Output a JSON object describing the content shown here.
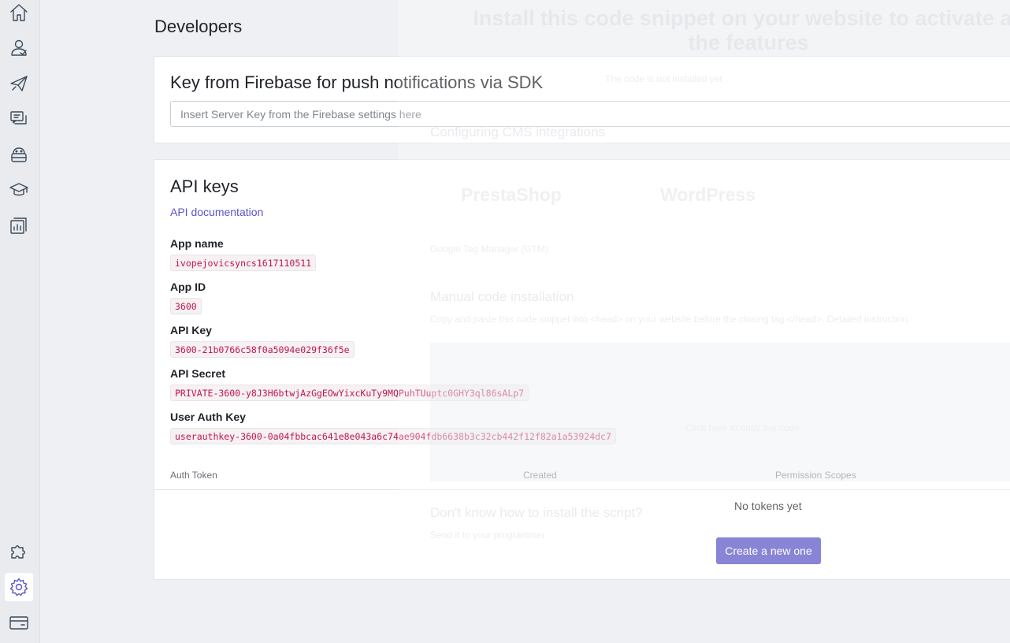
{
  "sidebar": {
    "top_icons": [
      "home-icon",
      "users-icon",
      "paper-plane-icon",
      "chat-icon",
      "bot-icon",
      "graduation-cap-icon",
      "reports-icon"
    ],
    "bottom_icons": [
      "puzzle-icon",
      "gear-icon",
      "card-icon"
    ],
    "active": "gear-icon"
  },
  "page": {
    "title": "Developers"
  },
  "firebase": {
    "title": "Key from Firebase for push notifications via SDK",
    "input_placeholder": "Insert Server Key from the Firebase settings here",
    "input_value": ""
  },
  "api": {
    "title": "API keys",
    "doc_link": "API documentation",
    "fields": [
      {
        "label": "App name",
        "value": "ivopejovicsyncs1617110511"
      },
      {
        "label": "App ID",
        "value": "3600"
      },
      {
        "label": "API Key",
        "value": "3600-21b0766c58f0a5094e029f36f5e"
      },
      {
        "label": "API Secret",
        "value": "PRIVATE-3600-y8J3H6btwjAzGgEOwYixcKuTy9MQPuhTUuptc0GHY3ql86sALp7"
      },
      {
        "label": "User Auth Key",
        "value": "userauthkey-3600-0a04fbbcac641e8e043a6c74ae904fdb6638b3c32cb442f12f82a1a53924dc7"
      }
    ],
    "table": {
      "headers": [
        "Auth Token",
        "Created",
        "Permission Scopes"
      ],
      "empty": "No tokens yet",
      "create_button": "Create a new one"
    }
  },
  "background_panel": {
    "heading": "Install this code snippet on your website to activate all the features",
    "status_text": "The code is not installed yet",
    "cms_heading": "Configuring CMS integrations",
    "cms_logos": [
      "PrestaShop",
      "WordPress"
    ],
    "gtm_text": "Google Tag Manager (GTM)",
    "manual_heading": "Manual code installation",
    "manual_text": "Copy and paste this code snippet into <head> on your website before the closing tag </head>. Detailed instruction",
    "copy_text": "Click here to copy the code",
    "help_heading": "Don't know how to install the script?",
    "help_link": "Send it to your programmer"
  },
  "colors": {
    "accent": "#5a55c7",
    "code_text": "#c0174a",
    "code_bg": "#f6f1f3"
  }
}
